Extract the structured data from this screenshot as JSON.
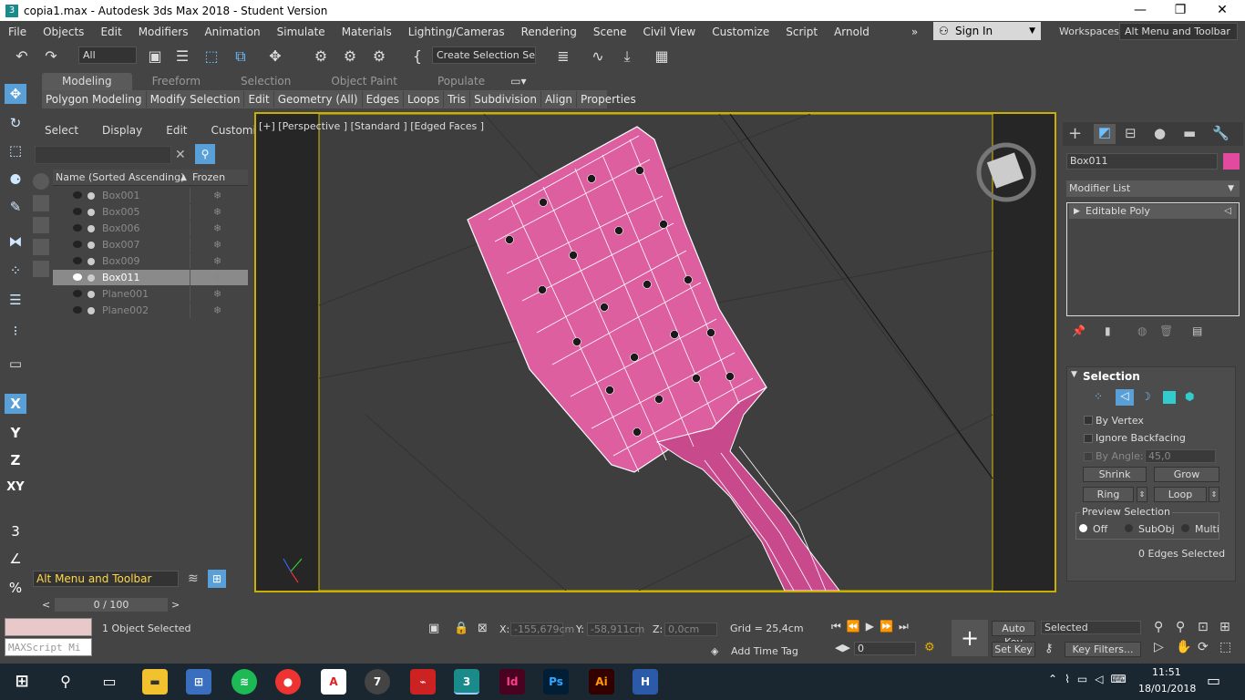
{
  "window": {
    "title": "copia1.max - Autodesk 3ds Max 2018 - Student Version",
    "minimize": "—",
    "maximize": "❐",
    "close": "✕"
  },
  "menu": [
    "File",
    "Objects",
    "Edit",
    "Modifiers",
    "Animation",
    "Simulate",
    "Materials",
    "Lighting/Cameras",
    "Rendering",
    "Scene",
    "Civil View",
    "Customize",
    "Script",
    "Arnold"
  ],
  "menu_more": "»",
  "signin": "Sign In",
  "workspaces": {
    "label": "Workspaces:",
    "value": "Alt Menu and Toolbar"
  },
  "toolbar": {
    "selection_filter": "All",
    "create_selection_set": "Create Selection Se"
  },
  "ribbon": {
    "tabs": [
      "Modeling",
      "Freeform",
      "Selection",
      "Object Paint",
      "Populate"
    ],
    "sub": [
      "Polygon Modeling",
      "Modify Selection",
      "Edit",
      "Geometry (All)",
      "Edges",
      "Loops",
      "Tris",
      "Subdivision",
      "Align",
      "Properties"
    ]
  },
  "scene_explorer": {
    "menu": [
      "Select",
      "Display",
      "Edit",
      "Customize"
    ],
    "col_name": "Name (Sorted Ascending)",
    "col_frozen": "Frozen",
    "sort_arrow": "▲",
    "rows": [
      {
        "name": "Box001"
      },
      {
        "name": "Box005"
      },
      {
        "name": "Box006"
      },
      {
        "name": "Box007"
      },
      {
        "name": "Box009"
      },
      {
        "name": "Box011"
      },
      {
        "name": "Plane001"
      },
      {
        "name": "Plane002"
      }
    ],
    "snowflake": "❄"
  },
  "layer": "Alt Menu and Toolbar",
  "time": {
    "slider": "0 / 100",
    "prev": "<",
    "next": ">"
  },
  "viewport": {
    "label": "[+] [Perspective ] [Standard ] [Edged Faces ]"
  },
  "command_panel": {
    "object_name": "Box011",
    "object_color": "#e24aa0",
    "modifier_list": "Modifier List",
    "stack_item": "Editable Poly",
    "selection": {
      "title": "Selection",
      "by_vertex": "By Vertex",
      "ignore_backfacing": "Ignore Backfacing",
      "by_angle": "By Angle:",
      "angle_value": "45,0",
      "shrink": "Shrink",
      "grow": "Grow",
      "ring": "Ring",
      "loop": "Loop",
      "preview": "Preview Selection",
      "off": "Off",
      "subobj": "SubObj",
      "multi": "Multi",
      "status": "0 Edges Selected"
    }
  },
  "status": {
    "maxscript": "MAXScript Mi",
    "objects_selected": "1 Object Selected",
    "x_label": "X:",
    "x": "-155,679cm",
    "y_label": "Y:",
    "y": "-58,911cm",
    "z_label": "Z:",
    "z": "0,0cm",
    "grid": "Grid = 25,4cm",
    "add_time_tag": "Add Time Tag",
    "auto_key": "Auto Key",
    "set_key": "Set Key",
    "key_mode": "Selected",
    "key_filters": "Key Filters...",
    "frame": "0"
  },
  "taskbar": {
    "time": "11:51",
    "date": "18/01/2018"
  }
}
